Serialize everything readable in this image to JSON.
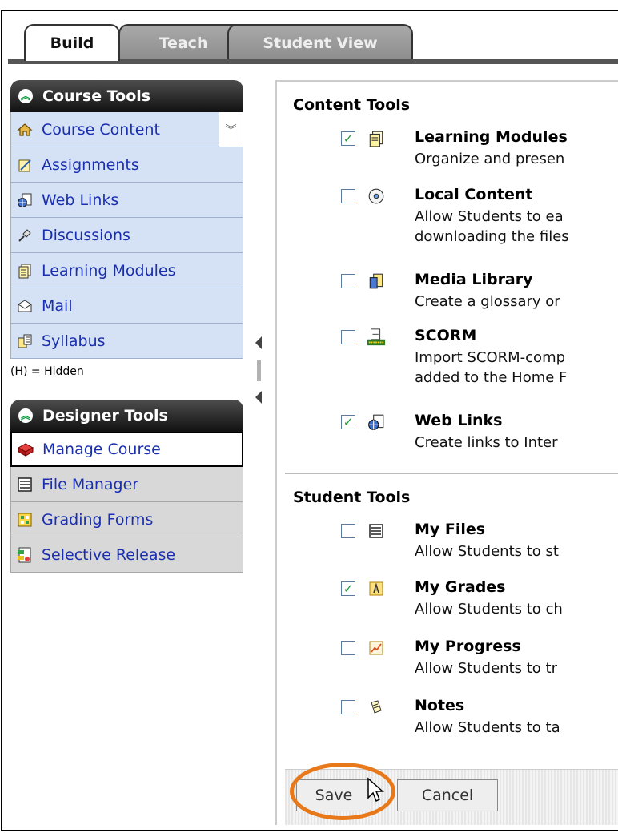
{
  "tabs": [
    {
      "label": "Build",
      "active": true
    },
    {
      "label": "Teach",
      "active": false
    },
    {
      "label": "Student View",
      "active": false
    }
  ],
  "sidebar": {
    "course_tools": {
      "title": "Course Tools",
      "items": [
        {
          "label": "Course Content",
          "icon": "home-icon"
        },
        {
          "label": "Assignments",
          "icon": "assignment-icon"
        },
        {
          "label": "Web Links",
          "icon": "globe-icon"
        },
        {
          "label": "Discussions",
          "icon": "pushpin-icon"
        },
        {
          "label": "Learning Modules",
          "icon": "document-icon"
        },
        {
          "label": "Mail",
          "icon": "envelope-icon"
        },
        {
          "label": "Syllabus",
          "icon": "book-icon"
        }
      ],
      "hidden_note": "(H) = Hidden"
    },
    "designer_tools": {
      "title": "Designer Tools",
      "items": [
        {
          "label": "Manage Course",
          "icon": "manage-course-icon"
        },
        {
          "label": "File Manager",
          "icon": "file-manager-icon"
        },
        {
          "label": "Grading Forms",
          "icon": "grading-forms-icon"
        },
        {
          "label": "Selective Release",
          "icon": "selective-release-icon"
        }
      ]
    }
  },
  "content": {
    "content_tools": {
      "title": "Content Tools",
      "items": [
        {
          "name": "Learning Modules",
          "desc": "Organize and presen",
          "checked": true
        },
        {
          "name": "Local Content",
          "desc": "Allow Students to ea\ndownloading the files",
          "checked": false
        },
        {
          "name": "Media Library",
          "desc": "Create a glossary or",
          "checked": false
        },
        {
          "name": "SCORM",
          "desc": "Import SCORM-comp\nadded to the Home F",
          "checked": false
        },
        {
          "name": "Web Links",
          "desc": "Create links to Inter",
          "checked": true
        }
      ]
    },
    "student_tools": {
      "title": "Student Tools",
      "items": [
        {
          "name": "My Files",
          "desc": "Allow Students to st",
          "checked": false
        },
        {
          "name": "My Grades",
          "desc": "Allow Students to ch",
          "checked": true
        },
        {
          "name": "My Progress",
          "desc": "Allow Students to tr",
          "checked": false
        },
        {
          "name": "Notes",
          "desc": "Allow Students to ta",
          "checked": false
        }
      ]
    },
    "buttons": {
      "save": "Save",
      "cancel": "Cancel"
    }
  },
  "colors": {
    "highlight_ring": "#e8791a",
    "check": "#1c9a2e",
    "nav_link": "#1a2fb0"
  }
}
